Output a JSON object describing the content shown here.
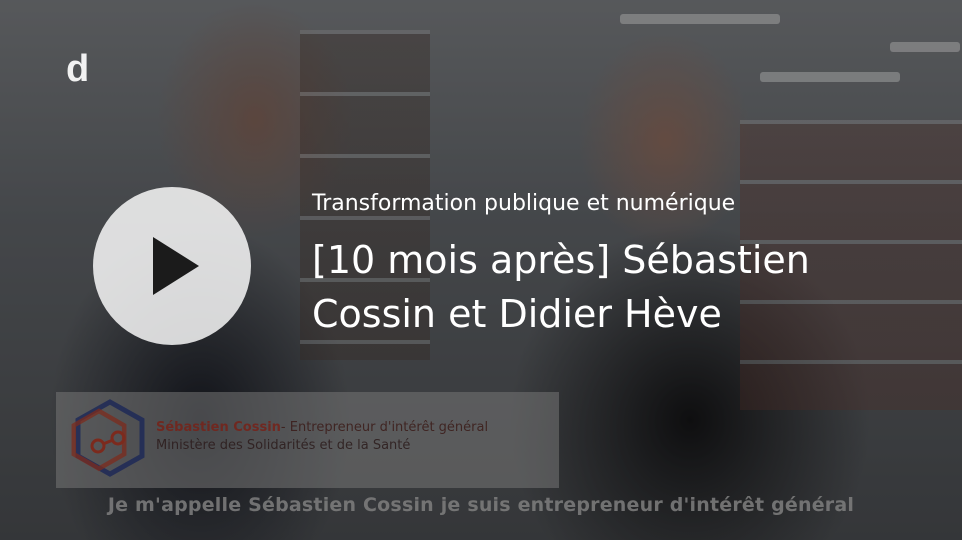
{
  "player": {
    "brand_logo_text": "d",
    "play_icon": "play-icon",
    "category": "Transformation publique et numérique",
    "title": "[10 mois après] Sébastien Cossin et Didier Hève"
  },
  "video_frame": {
    "lower_third": {
      "name": "Sébastien Cossin",
      "role": "- Entrepreneur d'intérêt général",
      "organization": "Ministère des Solidarités et de la Santé"
    },
    "subtitle": "Je m'appelle Sébastien Cossin je suis entrepreneur d'intérêt général"
  },
  "colors": {
    "overlay_text": "#ffffff",
    "play_button_bg": "#ffffff",
    "logo_blue": "#2c3e8c",
    "logo_red": "#c8452f"
  }
}
